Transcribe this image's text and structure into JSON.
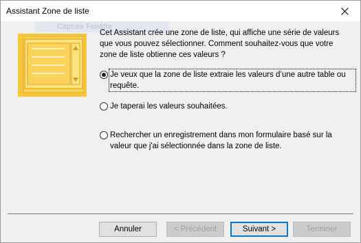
{
  "window": {
    "title": "Assistant Zone de liste",
    "ghost_overlay": "Capture Fenêtre"
  },
  "intro": "Cet Assistant crée une zone de liste, qui affiche une série de valeurs\nque vous pouvez sélectionner. Comment souhaitez-vous que votre\nzone de liste obtienne ces valeurs ?",
  "options": [
    {
      "label": "Je veux que la zone de liste extraie les valeurs d’une autre table ou requête.",
      "selected": true
    },
    {
      "label": "Je taperai les valeurs souhaitées.",
      "selected": false
    },
    {
      "label": "Rechercher un enregistrement dans mon formulaire basé sur la valeur que j'ai sélectionnée dans la zone de liste.",
      "selected": false
    }
  ],
  "buttons": {
    "cancel": "Annuler",
    "previous": "< Précédent",
    "next": "Suivant >",
    "finish": "Terminer"
  },
  "colors": {
    "illustration_fill": "#fbd35a",
    "illustration_dark": "#f0b92c",
    "default_button_border": "#0078d7"
  },
  "icons": {
    "close": "close-icon",
    "illustration": "listbox-illustration-icon"
  }
}
